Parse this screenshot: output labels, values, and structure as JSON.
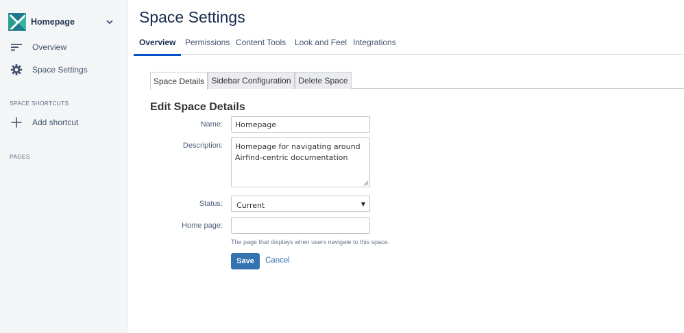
{
  "sidebar": {
    "space_name": "Homepage",
    "logo_icon": "space-logo-icon",
    "items": [
      {
        "label": "Overview",
        "icon": "overview-lines-icon"
      },
      {
        "label": "Space Settings",
        "icon": "gear-icon"
      }
    ],
    "shortcuts_heading": "SPACE SHORTCUTS",
    "add_shortcut_label": "Add shortcut",
    "pages_heading": "PAGES"
  },
  "header": {
    "title": "Space Settings",
    "tabs": [
      "Overview",
      "Permissions",
      "Content Tools",
      "Look and Feel",
      "Integrations"
    ],
    "active_tab": "Overview"
  },
  "subtabs": {
    "items": [
      "Space Details",
      "Sidebar Configuration",
      "Delete Space"
    ],
    "active": "Space Details"
  },
  "form": {
    "title": "Edit Space Details",
    "name_label": "Name:",
    "name_value": "Homepage",
    "description_label": "Description:",
    "description_line1": "Homepage for navigating around",
    "description_line2": "Airfind-centric documentation",
    "status_label": "Status:",
    "status_value": "Current",
    "homepage_label": "Home page:",
    "homepage_value": "",
    "homepage_help": "The page that displays when users navigate to this space.",
    "save_label": "Save",
    "cancel_label": "Cancel"
  },
  "colors": {
    "accent": "#0052cc",
    "button": "#3572b0",
    "sidebar_bg": "#f4f5f7",
    "logo_green": "#2a9d8f"
  }
}
